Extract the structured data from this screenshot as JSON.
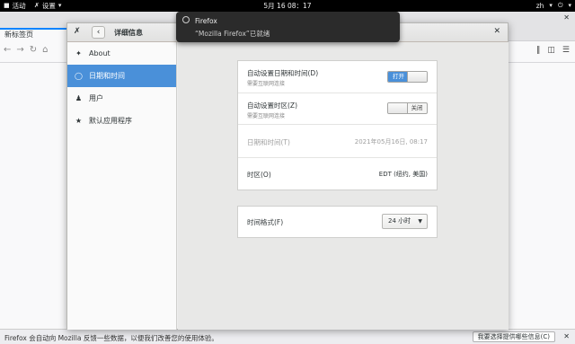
{
  "topbar": {
    "activities": "活动",
    "app_menu": "设置",
    "clock": "5月 16  08：17",
    "lang": "zh"
  },
  "firefox": {
    "tab_title": "新标签页",
    "status_message": "Firefox 会自动向 Mozilla 反馈一些数据，以便我们改善您的使用体验。",
    "status_button": "我要选择提供哪些信息(C)"
  },
  "settings": {
    "title": "详细信息",
    "sidebar": {
      "items": [
        {
          "label": "About",
          "icon": "star-icon",
          "active": false
        },
        {
          "label": "日期和时间",
          "icon": "clock-icon",
          "active": true
        },
        {
          "label": "用户",
          "icon": "users-icon",
          "active": false
        },
        {
          "label": "默认应用程序",
          "icon": "star-icon",
          "active": false
        }
      ]
    },
    "auto_datetime": {
      "label": "自动设置日期和时间(D)",
      "sub": "需要互联网连接",
      "state": "打开"
    },
    "auto_timezone": {
      "label": "自动设置时区(Z)",
      "sub": "需要互联网连接",
      "state": "关闭"
    },
    "datetime": {
      "label": "日期和时间(T)",
      "value": "2021年05月16日, 08:17"
    },
    "timezone": {
      "label": "时区(O)",
      "value": "EDT (纽约, 美国)"
    },
    "time_format": {
      "label": "时间格式(F)",
      "value": "24 小时"
    }
  },
  "notification": {
    "title": "Firefox",
    "body": "“Mozilla Firefox”已就绪"
  },
  "colors": {
    "accent": "#4a90d9",
    "topbar": "#000000",
    "notification": "#2b2b2b"
  }
}
